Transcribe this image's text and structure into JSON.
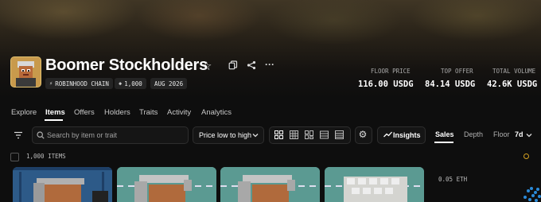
{
  "collection": {
    "name": "Boomer Stockholders",
    "chips": [
      "ROBINHOOD CHAIN",
      "1,000",
      "AUG 2026"
    ]
  },
  "stats": [
    {
      "label": "FLOOR PRICE",
      "value": "116.00 USDG"
    },
    {
      "label": "TOP OFFER",
      "value": "84.14 USDG"
    },
    {
      "label": "TOTAL VOLUME",
      "value": "42.6K USDG"
    }
  ],
  "tabs": [
    "Explore",
    "Items",
    "Offers",
    "Holders",
    "Traits",
    "Activity",
    "Analytics"
  ],
  "active_tab": "Items",
  "toolbar": {
    "search_placeholder": "Search by item or trait",
    "sort_label": "Price low to high",
    "insights_label": "Insights"
  },
  "right_panel": {
    "tabs": [
      "Sales",
      "Depth",
      "Floor"
    ],
    "active": "Sales",
    "period": "7d",
    "price_label": "0.05 ETH"
  },
  "items_count": "1,000 ITEMS",
  "colors": {
    "background": "#0e0e0e",
    "card_teal": "#5b9a92",
    "card_blue": "#2d5a88",
    "accent_gold": "#d4a020"
  }
}
